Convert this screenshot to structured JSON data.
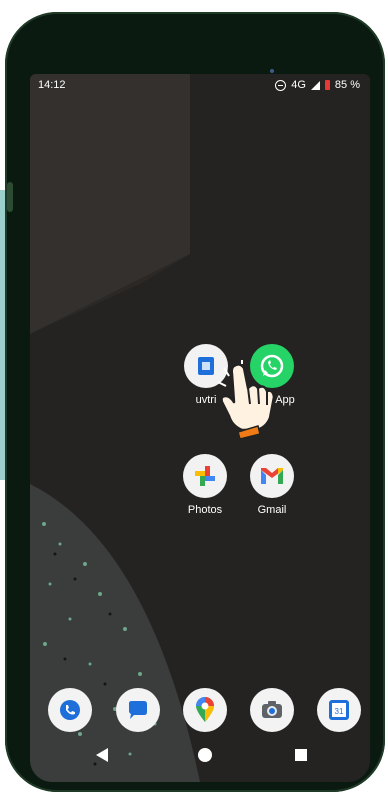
{
  "status_bar": {
    "time": "14:12",
    "network": "4G",
    "battery": "85 %"
  },
  "home_apps": [
    {
      "label": "uvtri",
      "icon": "file-manager-icon"
    },
    {
      "label": "App",
      "icon": "whatsapp-icon"
    },
    {
      "label": "Photos",
      "icon": "google-photos-icon"
    },
    {
      "label": "Gmail",
      "icon": "gmail-icon"
    }
  ],
  "dock": [
    {
      "icon": "phone-icon"
    },
    {
      "icon": "messages-icon"
    },
    {
      "icon": "maps-icon"
    },
    {
      "icon": "camera-icon"
    },
    {
      "icon": "calendar-icon",
      "text": "31"
    }
  ],
  "colors": {
    "wallpaper": "#252322",
    "phone_frame": "#0b1a10",
    "whatsapp_green": "#25d366",
    "files_blue": "#1e6fd9"
  }
}
